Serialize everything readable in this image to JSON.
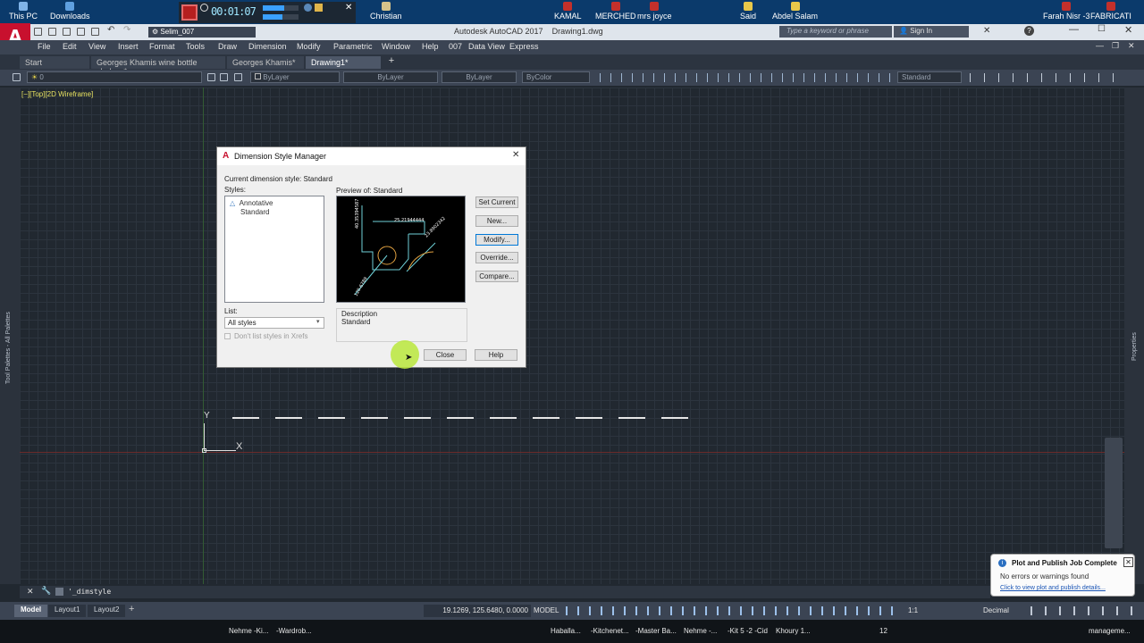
{
  "desktop": {
    "icons": [
      "This PC",
      "Downloads",
      "Christian",
      "KAMAL",
      "MERCHED",
      "mrs joyce",
      "Said",
      "Abdel Salam",
      "Farah Nisr -3",
      "FABRICATI"
    ],
    "recorder": {
      "time": "00:01:07",
      "profile": "Selim_007"
    }
  },
  "titlebar": {
    "app": "Autodesk AutoCAD 2017",
    "file": "Drawing1.dwg",
    "search_placeholder": "Type a keyword or phrase",
    "sign_in": "Sign In"
  },
  "menu": [
    "File",
    "Edit",
    "View",
    "Insert",
    "Format",
    "Tools",
    "Draw",
    "Dimension",
    "Modify",
    "Parametric",
    "Window",
    "Help",
    "007",
    "Data View",
    "Express"
  ],
  "doc_tabs": [
    {
      "label": "Start",
      "active": false
    },
    {
      "label": "Georges Khamis wine bottle shelves*",
      "active": false
    },
    {
      "label": "Georges Khamis*",
      "active": false
    },
    {
      "label": "Drawing1*",
      "active": true
    }
  ],
  "properties": {
    "layer": "0",
    "color": "ByLayer",
    "linetype": "ByLayer",
    "lineweight": "ByLayer",
    "plotstyle": "ByColor",
    "textstyle": "Standard"
  },
  "viewport_label": "[−][Top][2D Wireframe]",
  "side_palettes": {
    "left": "Tool Palettes - All Palettes",
    "right": "Properties"
  },
  "dialog": {
    "title": "Dimension Style Manager",
    "current_style": "Current dimension style: Standard",
    "styles_label": "Styles:",
    "styles": [
      "Annotative",
      "Standard"
    ],
    "preview_label": "Preview of: Standard",
    "list_label": "List:",
    "list_value": "All styles",
    "xref_checkbox": "Don't list styles in Xrefs",
    "description_label": "Description",
    "description_value": "Standard",
    "buttons": {
      "set_current": "Set Current",
      "new": "New...",
      "modify": "Modify...",
      "override": "Override...",
      "compare": "Compare...",
      "close": "Close",
      "help": "Help"
    },
    "preview_dims": [
      "25.21944444",
      "40.35394587",
      "23.8902342",
      "120.6789"
    ]
  },
  "ucs": {
    "x": "X",
    "y": "Y"
  },
  "command_line": {
    "text": "'_dimstyle"
  },
  "layout_tabs": [
    "Model",
    "Layout1",
    "Layout2"
  ],
  "statusbar": {
    "coords": "19.1269, 125.6480, 0.0000",
    "space": "MODEL",
    "scale": "1:1",
    "units": "Decimal"
  },
  "notification": {
    "title": "Plot and Publish Job Complete",
    "message": "No errors or warnings found",
    "link": "Click to view plot and publish details..."
  },
  "taskbar": [
    "Nehme -Ki...",
    "-Wardrob...",
    "Haballa...",
    "-Kitchenet...",
    "-Master Ba...",
    "Nehme -...",
    "-Kit 5 -2 -Cid",
    "Khoury 1...",
    "12",
    "manageme..."
  ],
  "colors": {
    "accent": "#0078d7",
    "brand": "#c8102e",
    "canvas": "#212830"
  }
}
